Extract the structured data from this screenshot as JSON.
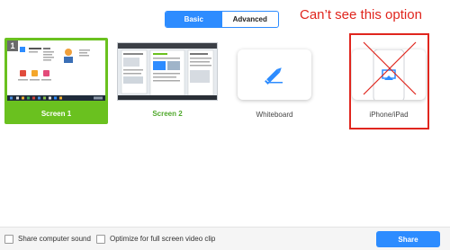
{
  "tabs": [
    {
      "label": "Basic",
      "active": true
    },
    {
      "label": "Advanced",
      "active": false
    }
  ],
  "annotation": "Can’t see this option",
  "options": [
    {
      "label": "Screen 1",
      "badge": "1",
      "selected": true
    },
    {
      "label": "Screen 2",
      "selected": false
    },
    {
      "label": "Whiteboard",
      "icon": "pencil-icon",
      "selected": false
    },
    {
      "label": "iPhone/iPad",
      "icon": "airplay-icon",
      "selected": false,
      "crossed_out": true
    }
  ],
  "footer": {
    "share_sound_label": "Share computer sound",
    "share_sound_checked": false,
    "optimize_label": "Optimize for full screen video clip",
    "optimize_checked": false,
    "share_button": "Share"
  },
  "colors": {
    "accent": "#2d8cff",
    "selected_card": "#6ac11f",
    "annotation": "#e0261e"
  }
}
